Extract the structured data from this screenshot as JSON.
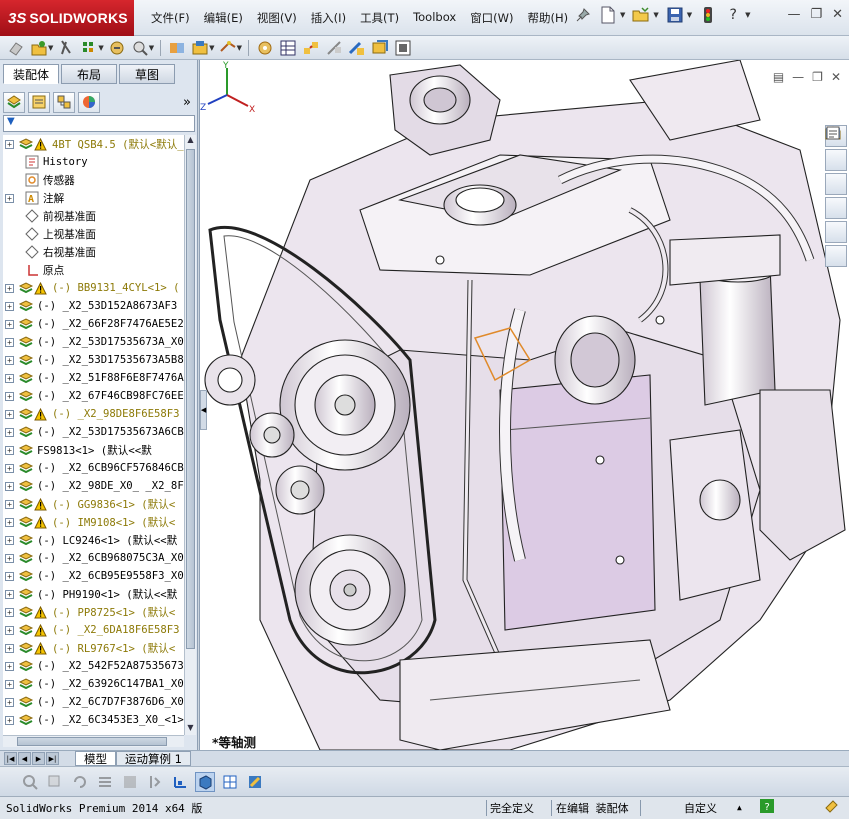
{
  "app": {
    "brand_ds": "3S",
    "brand_name": "SOLIDWORKS"
  },
  "menu": [
    {
      "label": "文件(F)"
    },
    {
      "label": "编辑(E)"
    },
    {
      "label": "视图(V)"
    },
    {
      "label": "插入(I)"
    },
    {
      "label": "工具(T)"
    },
    {
      "label": "Toolbox"
    },
    {
      "label": "窗口(W)"
    },
    {
      "label": "帮助(H)"
    }
  ],
  "panel": {
    "tabs": [
      "装配体",
      "布局",
      "草图"
    ],
    "filter_symbol": "▼"
  },
  "tree": {
    "root": "4BT QSB4.5  (默认<默认_显",
    "fixed": [
      "History",
      "传感器",
      "注解",
      "前视基准面",
      "上视基准面",
      "右视基准面",
      "原点"
    ],
    "components": [
      {
        "label": "(-) BB9131_4CYL<1> (",
        "warn": true
      },
      {
        "label": "(-) _X2_53D152A8673AF3",
        "warn": false
      },
      {
        "label": "(-) _X2_66F28F7476AE5E2",
        "warn": false
      },
      {
        "label": "(-) _X2_53D17535673A_X0",
        "warn": false
      },
      {
        "label": "(-) _X2_53D17535673A5B8",
        "warn": false
      },
      {
        "label": "(-) _X2_51F88F6E8F7476A",
        "warn": false
      },
      {
        "label": "(-) _X2_67F46CB98FC76EE",
        "warn": false
      },
      {
        "label": "(-) _X2_98DE8F6E58F3",
        "warn": true
      },
      {
        "label": "(-) _X2_53D17535673A6CB",
        "warn": false
      },
      {
        "label": "FS9813<1> (默认<<默",
        "warn": false
      },
      {
        "label": "(-) _X2_6CB96CF576846CB",
        "warn": false
      },
      {
        "label": "(-) _X2_98DE_X0_ _X2_8F",
        "warn": false
      },
      {
        "label": "(-) GG9836<1> (默认<",
        "warn": true
      },
      {
        "label": "(-) IM9108<1> (默认<",
        "warn": true
      },
      {
        "label": "(-) LC9246<1> (默认<<默",
        "warn": false
      },
      {
        "label": "(-) _X2_6CB968075C3A_X0",
        "warn": false
      },
      {
        "label": "(-) _X2_6CB95E9558F3_X0",
        "warn": false
      },
      {
        "label": "(-) PH9190<1> (默认<<默",
        "warn": false
      },
      {
        "label": "(-) PP8725<1> (默认<",
        "warn": true
      },
      {
        "label": "(-) _X2_6DA18F6E58F3",
        "warn": true
      },
      {
        "label": "(-) RL9767<1> (默认<",
        "warn": true
      },
      {
        "label": "(-) _X2_542F52A87535673",
        "warn": false
      },
      {
        "label": "(-) _X2_63926C147BA1_X0",
        "warn": false
      },
      {
        "label": "(-) _X2_6C7D7F3876D6_X0",
        "warn": false
      },
      {
        "label": "(-) _X2_6C3453E3_X0_<1>",
        "warn": false
      }
    ]
  },
  "viewport": {
    "view_label": "*等轴测",
    "triad": {
      "x": "X",
      "y": "Y",
      "z": "Z"
    }
  },
  "bottom_tabs": [
    "模型",
    "运动算例 1"
  ],
  "status": {
    "product": "SolidWorks Premium 2014 x64 版",
    "state": "完全定义",
    "mode": "在编辑 装配体",
    "units": "自定义"
  },
  "colors": {
    "brand_red": "#c41a22",
    "warning_yellow": "#f5c400",
    "model_fill": "#ede6ef",
    "selection_orange": "#e08a2a"
  }
}
